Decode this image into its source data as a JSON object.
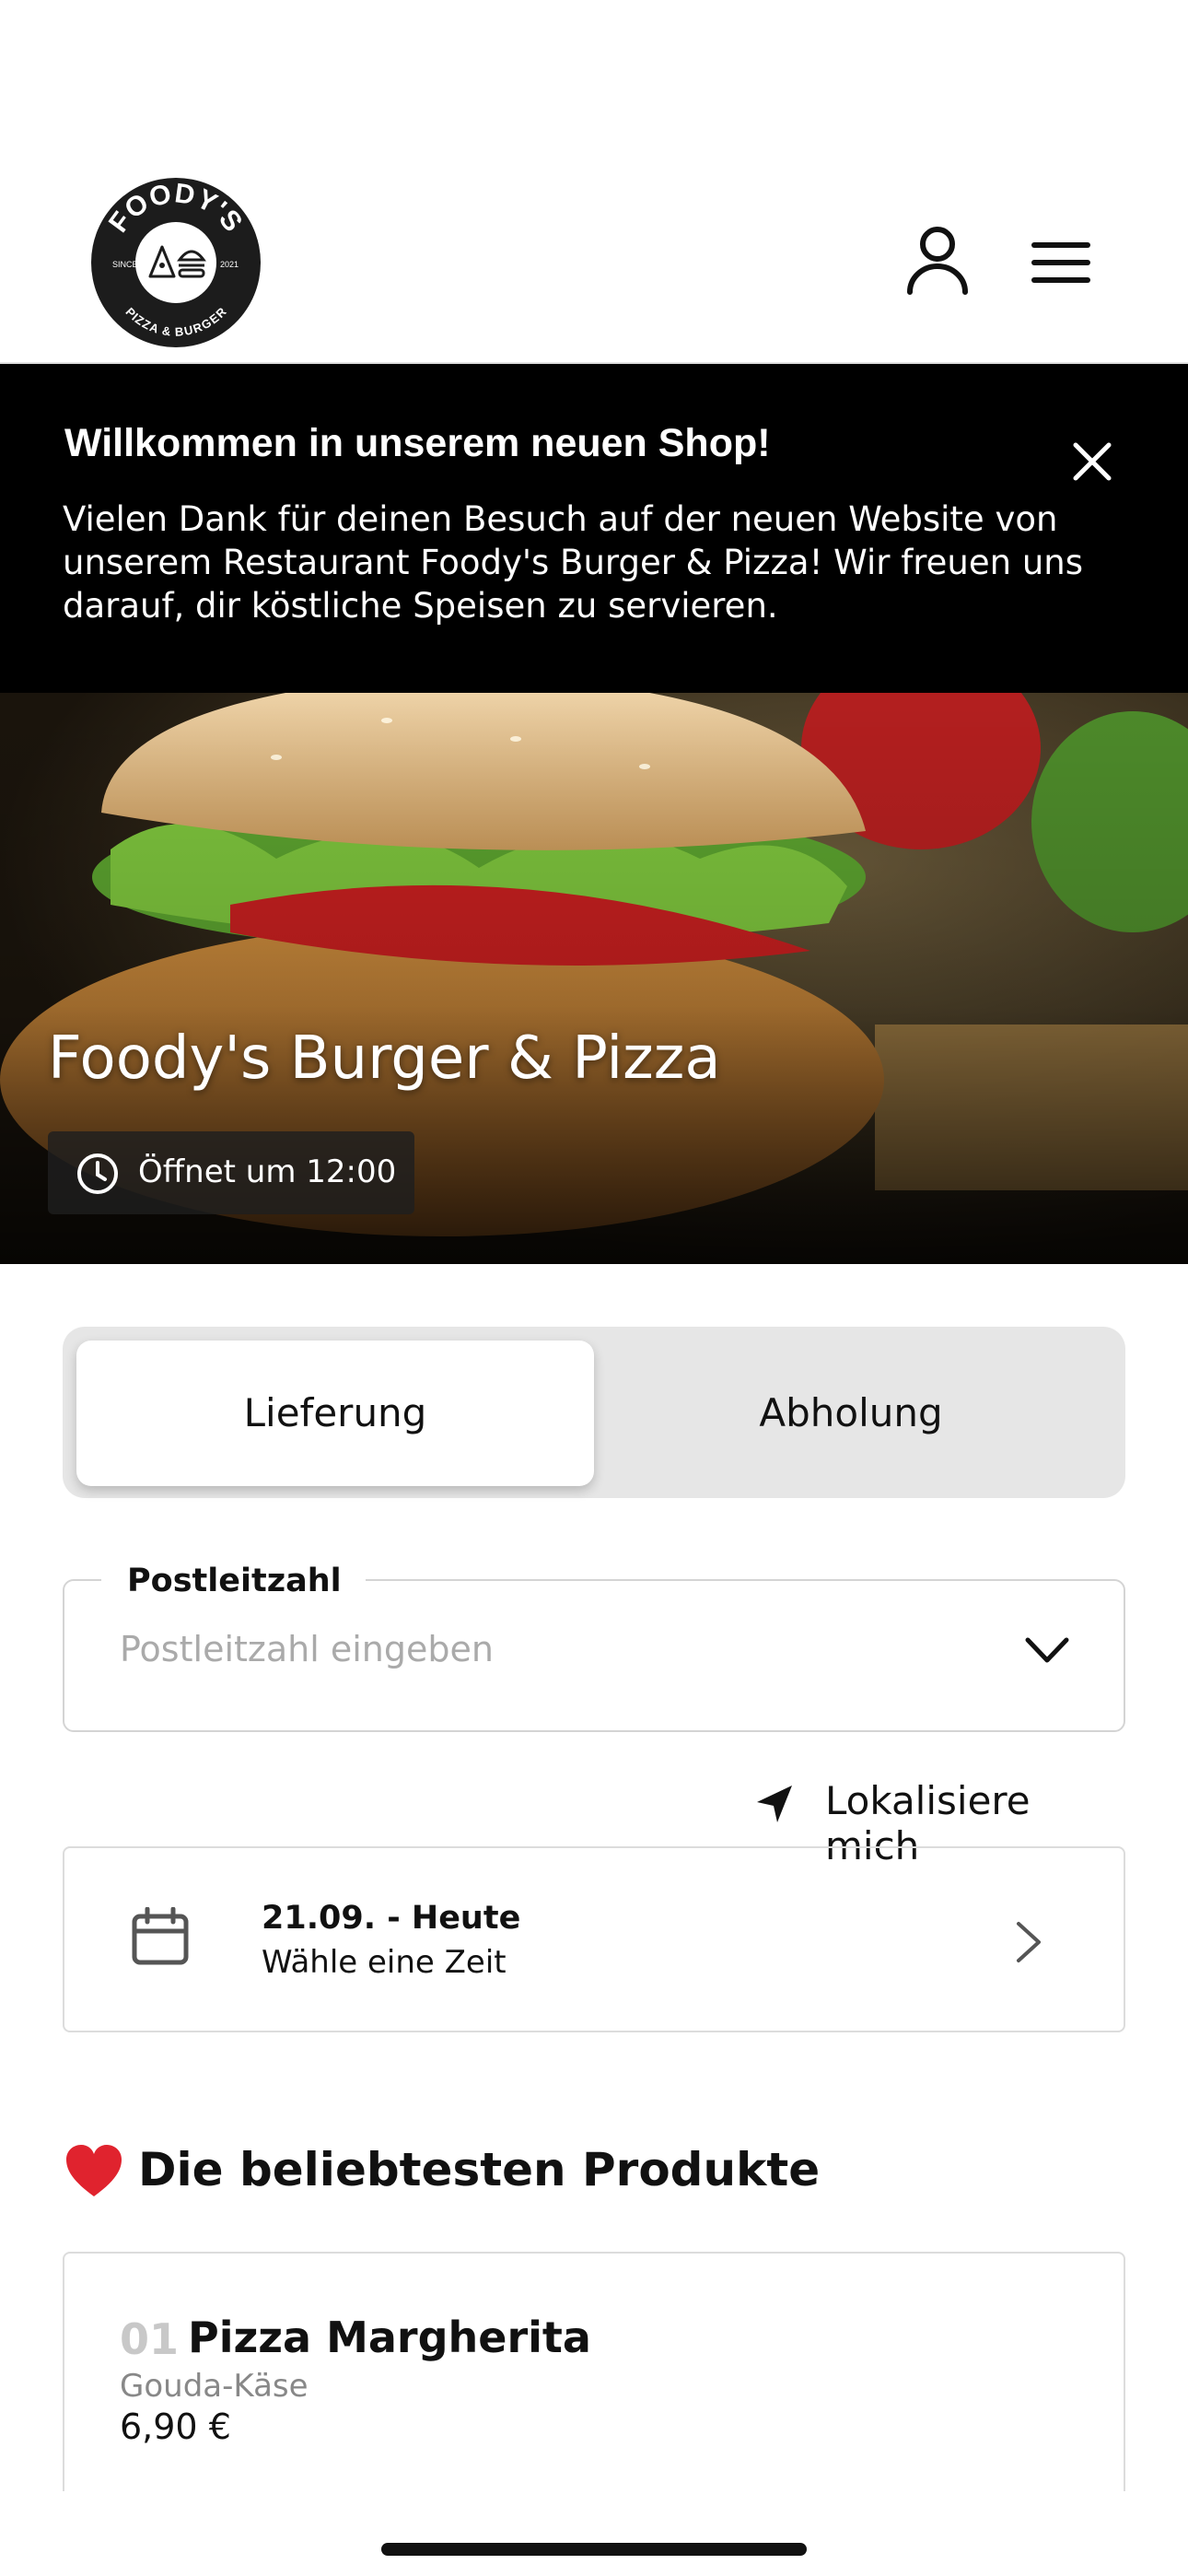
{
  "header": {
    "logo": {
      "text_top": "FOODY'S",
      "text_bottom": "PIZZA & BURGER",
      "since_label": "SINCE",
      "year": "2021"
    },
    "icons": [
      "user-icon",
      "menu-icon"
    ]
  },
  "banner": {
    "title": "Willkommen in unserem neuen Shop!",
    "text": "Vielen Dank für deinen Besuch auf der neuen Website von unserem Restaurant Foody's Burger & Pizza! Wir freuen uns darauf, dir köstliche Speisen zu servieren."
  },
  "hero": {
    "title": "Foody's Burger & Pizza",
    "opening": "Öffnet um 12:00"
  },
  "order_mode": {
    "delivery": "Lieferung",
    "pickup": "Abholung",
    "selected": "Lieferung"
  },
  "zip": {
    "label": "Postleitzahl",
    "placeholder": "Postleitzahl eingeben",
    "value": ""
  },
  "locate": {
    "label": "Lokalisiere mich"
  },
  "date": {
    "main": "21.09. - Heute",
    "sub": "Wähle eine Zeit"
  },
  "popular": {
    "title": "Die beliebtesten Produkte",
    "emoji": "heart",
    "items": [
      {
        "number": "01",
        "name": "Pizza Margherita",
        "description": "Gouda-Käse",
        "price": "6,90 €"
      }
    ]
  },
  "colors": {
    "banner_bg": "#000000",
    "segment_bg": "#e6e6e6",
    "heart": "#e0232e"
  }
}
